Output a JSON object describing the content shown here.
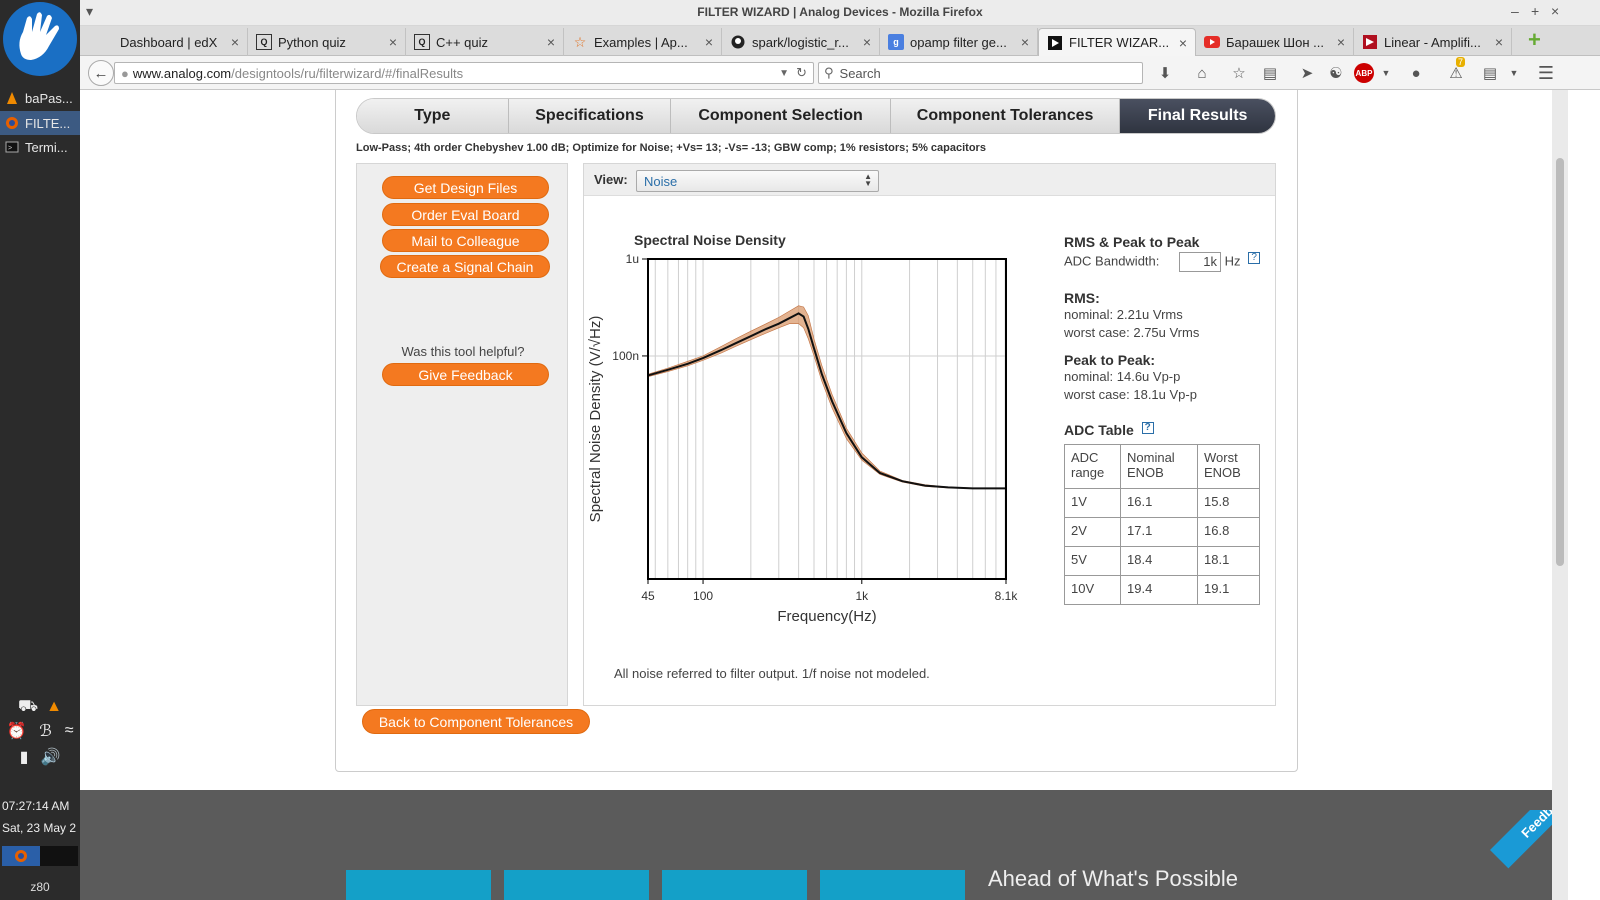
{
  "desktop": {
    "tasks": [
      {
        "label": "baPas...",
        "icon": "vlc-icon",
        "active": false
      },
      {
        "label": "FILTE...",
        "icon": "firefox-icon",
        "active": true
      },
      {
        "label": "Termi...",
        "icon": "terminal-icon",
        "active": false
      }
    ],
    "clock_time": "07:27:14 AM",
    "clock_date": "Sat, 23 May 2",
    "hostname": "z80"
  },
  "browser": {
    "window_title": "FILTER WIZARD | Analog Devices - Mozilla Firefox",
    "tabs": [
      {
        "label": "Dashboard | edX",
        "icon": "blank",
        "active": false
      },
      {
        "label": "Python quiz",
        "icon": "quiz",
        "active": false
      },
      {
        "label": "C++ quiz",
        "icon": "quiz",
        "active": false
      },
      {
        "label": "Examples | Ap...",
        "icon": "star",
        "active": false
      },
      {
        "label": "spark/logistic_r...",
        "icon": "github",
        "active": false
      },
      {
        "label": "opamp filter ge...",
        "icon": "google",
        "active": false
      },
      {
        "label": "FILTER WIZAR...",
        "icon": "analog",
        "active": true
      },
      {
        "label": "Барашек Шон ...",
        "icon": "youtube",
        "active": false
      },
      {
        "label": "Linear - Amplifi...",
        "icon": "linear",
        "active": false
      }
    ],
    "url_host": "www.analog.com",
    "url_path": "/designtools/ru/filterwizard/#/finalResults",
    "search_placeholder": "Search",
    "notification_count": "7"
  },
  "wizard": {
    "steps": [
      "Type",
      "Specifications",
      "Component Selection",
      "Component Tolerances",
      "Final Results"
    ],
    "active_step": 4,
    "summary": "Low-Pass; 4th order Chebyshev 1.00 dB; Optimize for Noise; +Vs= 13; -Vs= -13; GBW comp; 1% resistors; 5% capacitors",
    "actions": {
      "design_files": "Get Design Files",
      "eval_board": "Order Eval Board",
      "mail": "Mail to Colleague",
      "signal_chain": "Create a Signal Chain",
      "helpful_question": "Was this tool helpful?",
      "feedback": "Give Feedback"
    },
    "view_label": "View:",
    "view_value": "Noise",
    "noise_note": "All noise referred to filter output. 1/f noise not modeled.",
    "back_button": "Back to Component Tolerances"
  },
  "results": {
    "rms_peak_title": "RMS & Peak to Peak",
    "adc_bandwidth_label": "ADC Bandwidth:",
    "adc_bandwidth_value": "1k",
    "adc_bandwidth_unit": "Hz",
    "rms_title": "RMS:",
    "rms_nominal": "nominal: 2.21u Vrms",
    "rms_worst": "worst case: 2.75u Vrms",
    "pp_title": "Peak to Peak:",
    "pp_nominal": "nominal: 14.6u Vp-p",
    "pp_worst": "worst case: 18.1u Vp-p",
    "adc_table_title": "ADC Table",
    "adc_table": {
      "headers": [
        "ADC range",
        "Nominal ENOB",
        "Worst ENOB"
      ],
      "rows": [
        [
          "1V",
          "16.1",
          "15.8"
        ],
        [
          "2V",
          "17.1",
          "16.8"
        ],
        [
          "5V",
          "18.4",
          "18.1"
        ],
        [
          "10V",
          "19.4",
          "19.1"
        ]
      ]
    }
  },
  "chart_data": {
    "type": "line",
    "title": "Spectral Noise Density",
    "xlabel": "Frequency(Hz)",
    "ylabel": "Spectral Noise Density (V/√Hz)",
    "x_scale": "log",
    "y_scale": "log",
    "xlim": [
      45,
      8100
    ],
    "ylim": [
      5e-10,
      1e-06
    ],
    "x_tick_labels": [
      "45",
      "100",
      "1k",
      "8.1k"
    ],
    "x_ticks": [
      45,
      100,
      1000,
      8100
    ],
    "y_tick_labels": [
      "1u",
      "100n"
    ],
    "y_ticks": [
      1e-06,
      1e-07
    ],
    "grid": true,
    "x": [
      45,
      60,
      80,
      100,
      130,
      160,
      200,
      250,
      300,
      350,
      400,
      430,
      460,
      500,
      560,
      650,
      800,
      1000,
      1300,
      1800,
      2500,
      3500,
      5000,
      8100
    ],
    "series": [
      {
        "values": [
          6.3e-08,
          7.2e-08,
          8.3e-08,
          9.5e-08,
          1.15e-07,
          1.35e-07,
          1.6e-07,
          1.9e-07,
          2.15e-07,
          2.45e-07,
          2.75e-07,
          2.55e-07,
          1.9e-07,
          1.2e-07,
          6.5e-08,
          3.4e-08,
          1.6e-08,
          9e-09,
          6.2e-09,
          5.1e-09,
          4.6e-09,
          4.4e-09,
          4.3e-09,
          4.3e-09
        ]
      },
      {
        "values": [
          6.1e-08,
          6.9e-08,
          7.9e-08,
          9e-08,
          1.07e-07,
          1.25e-07,
          1.47e-07,
          1.72e-07,
          1.95e-07,
          2.15e-07,
          2.15e-07,
          1.95e-07,
          1.5e-07,
          1e-07,
          5.5e-08,
          2.9e-08,
          1.4e-08,
          8.4e-09,
          6e-09,
          5e-09,
          4.5e-09,
          4.35e-09,
          4.3e-09,
          4.3e-09
        ]
      },
      {
        "values": [
          6.5e-08,
          7.5e-08,
          8.8e-08,
          1e-07,
          1.25e-07,
          1.5e-07,
          1.8e-07,
          2.15e-07,
          2.5e-07,
          2.9e-07,
          3.3e-07,
          3.2e-07,
          2.6e-07,
          1.5e-07,
          8e-08,
          4e-08,
          1.8e-08,
          1e-08,
          6.5e-09,
          5.2e-09,
          4.7e-09,
          4.45e-09,
          4.35e-09,
          4.3e-09
        ]
      }
    ],
    "colors": {
      "nominal": "#111111",
      "band": "#d99a6c"
    }
  },
  "footer": {
    "tagline": "Ahead of What's Possible",
    "feedback_tab": "Feedback"
  }
}
